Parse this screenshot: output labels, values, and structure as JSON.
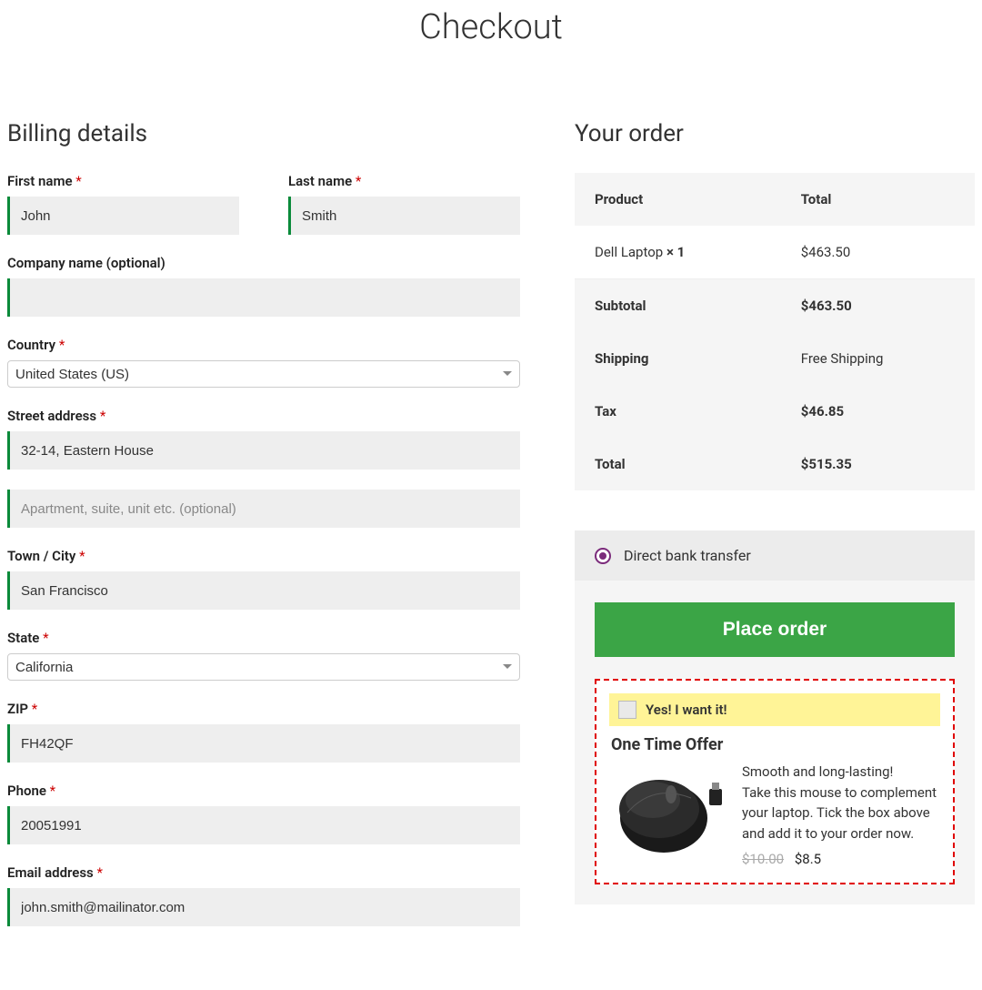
{
  "page_title": "Checkout",
  "billing": {
    "heading": "Billing details",
    "first_name_label": "First name",
    "first_name_value": "John",
    "last_name_label": "Last name",
    "last_name_value": "Smith",
    "company_label": "Company name (optional)",
    "company_value": "",
    "country_label": "Country",
    "country_value": "United States (US)",
    "street_label": "Street address",
    "street_value": "32-14, Eastern House",
    "street2_placeholder": "Apartment, suite, unit etc. (optional)",
    "city_label": "Town / City",
    "city_value": "San Francisco",
    "state_label": "State",
    "state_value": "California",
    "zip_label": "ZIP",
    "zip_value": "FH42QF",
    "phone_label": "Phone",
    "phone_value": "20051991",
    "email_label": "Email address",
    "email_value": "john.smith@mailinator.com",
    "required_mark": "*"
  },
  "order": {
    "heading": "Your order",
    "col_product": "Product",
    "col_total": "Total",
    "item_name": "Dell Laptop ",
    "item_qty": "× 1",
    "item_total": "$463.50",
    "subtotal_label": "Subtotal",
    "subtotal_value": "$463.50",
    "shipping_label": "Shipping",
    "shipping_value": "Free Shipping",
    "tax_label": "Tax",
    "tax_value": "$46.85",
    "total_label": "Total",
    "total_value": "$515.35"
  },
  "payment": {
    "method_label": "Direct bank transfer"
  },
  "place_order_label": "Place order",
  "offer": {
    "yes_label": "Yes! I want it!",
    "title": "One Time Offer",
    "line1": "Smooth and long-lasting!",
    "line2": "Take this mouse to complement your laptop. Tick the box above and add it to your order now.",
    "old_price": "$10.00",
    "new_price": "$8.5"
  }
}
